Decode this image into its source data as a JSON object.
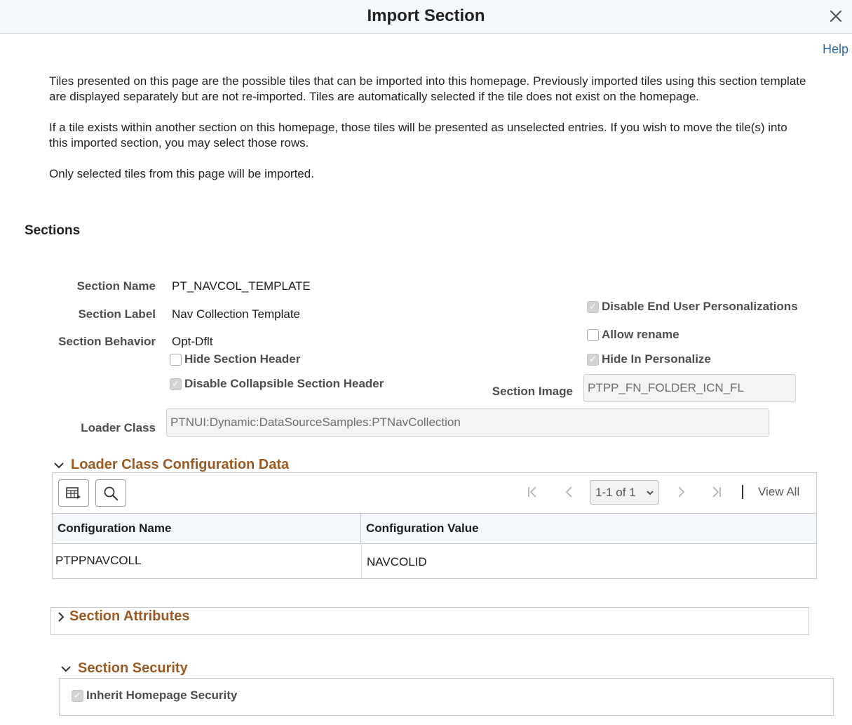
{
  "window": {
    "title": "Import Section",
    "close_icon": "close-icon"
  },
  "help": {
    "label": "Help"
  },
  "intro": {
    "p1": "Tiles presented on this page are the possible tiles that can be imported into this homepage.  Previously imported tiles using this section template are displayed separately but are not re-imported.  Tiles are automatically selected if the tile does not exist on the homepage.",
    "p2": "If a tile exists within another section on this homepage, those tiles will be presented as unselected entries.  If you wish to move the tile(s) into this imported section, you may select those rows.",
    "p3": "Only selected tiles from this page will be imported."
  },
  "sections": {
    "heading": "Sections",
    "section_name": {
      "label": "Section Name",
      "value": "PT_NAVCOL_TEMPLATE"
    },
    "section_label": {
      "label": "Section Label",
      "value": "Nav Collection Template"
    },
    "section_behavior": {
      "label": "Section Behavior",
      "value": "Opt-Dflt"
    },
    "hide_section_header": {
      "label": "Hide Section Header",
      "checked": false
    },
    "disable_collapsible": {
      "label": "Disable Collapsible Section Header",
      "checked": true
    },
    "disable_personalizations": {
      "label": "Disable End User Personalizations",
      "checked": true
    },
    "allow_rename": {
      "label": "Allow rename",
      "checked": false
    },
    "hide_in_personalize": {
      "label": "Hide In Personalize",
      "checked": true
    },
    "section_image": {
      "label": "Section Image",
      "value": "PTPP_FN_FOLDER_ICN_FL"
    },
    "loader_class": {
      "label": "Loader Class",
      "value": "PTNUI:Dynamic:DataSourceSamples:PTNavCollection"
    }
  },
  "loader_config": {
    "title": "Loader Class Configuration Data",
    "expanded": true,
    "pager": {
      "range": "1-1 of 1",
      "view_all": "View All"
    },
    "columns": [
      "Configuration Name",
      "Configuration Value"
    ],
    "rows": [
      [
        "PTPPNAVCOLL",
        "NAVCOLID"
      ]
    ]
  },
  "section_attributes": {
    "title": "Section Attributes",
    "expanded": false
  },
  "section_security": {
    "title": "Section Security",
    "expanded": true,
    "inherit": {
      "label": "Inherit Homepage Security",
      "checked": true
    }
  },
  "colors": {
    "accent_heading": "#9b5a22",
    "link": "#2c6bab",
    "titlebar_bg": "#f5f8fb"
  }
}
